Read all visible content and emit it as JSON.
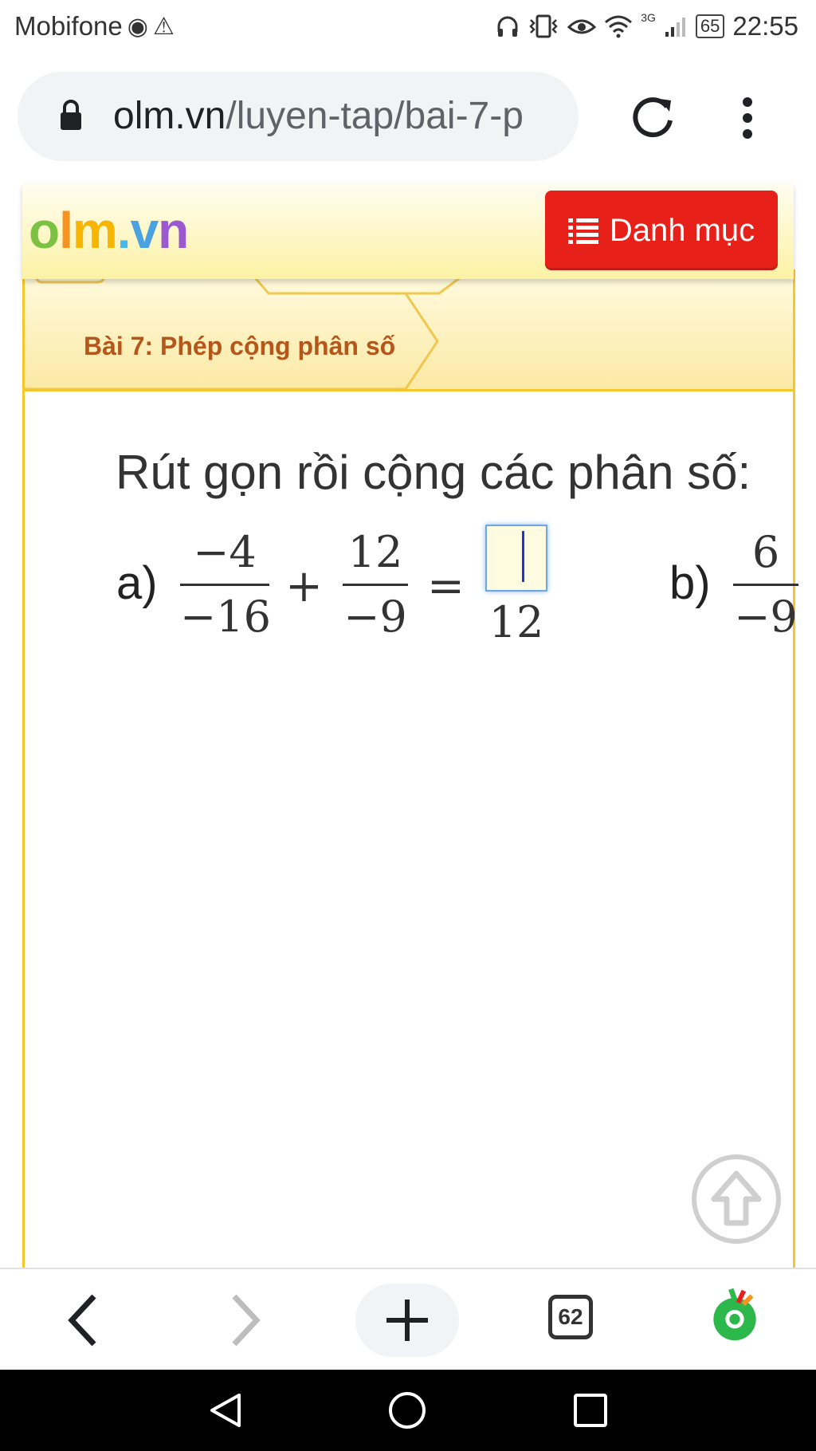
{
  "status_bar": {
    "carrier": "Mobifone",
    "network_type": "3G",
    "battery": "65",
    "time": "22:55"
  },
  "browser": {
    "url_host": "olm.vn",
    "url_path": "/luyen-tap/bai-7-p",
    "tab_count": "62"
  },
  "site": {
    "logo": {
      "o": "o",
      "l": "l",
      "m": "m",
      "dot": ".",
      "v": "v",
      "n": "n"
    },
    "menu_button": "Danh mục",
    "breadcrumb": "Bài 7: Phép cộng phân số"
  },
  "exercise": {
    "prompt": "Rút gọn rồi cộng các phân số:",
    "part_a": {
      "label": "a)",
      "frac1": {
        "num": "−4",
        "den": "−16"
      },
      "plus": "+",
      "frac2": {
        "num": "12",
        "den": "−9"
      },
      "equals": "=",
      "answer_numerator": "",
      "answer_denominator": "12"
    },
    "part_b": {
      "label": "b)",
      "frac1": {
        "num": "6",
        "den": "−9"
      }
    }
  },
  "colors": {
    "menu_button": "#e8201a",
    "frame_border": "#f4c82a",
    "breadcrumb_text": "#b5561b",
    "caret": "#2334d6",
    "app_icon_green": "#2db84b"
  }
}
